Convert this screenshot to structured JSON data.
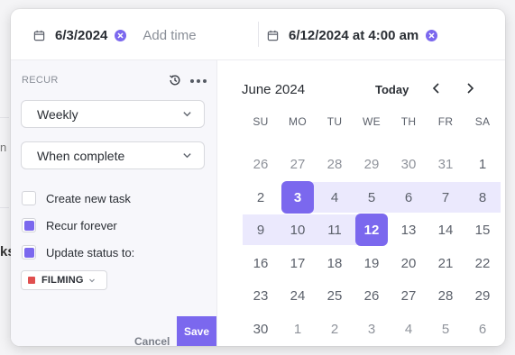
{
  "background": {
    "fragment_1": "n",
    "fragment_2": "ks"
  },
  "header": {
    "start_date": "6/3/2024",
    "add_time_placeholder": "Add time",
    "due_date": "6/12/2024 at 4:00 am"
  },
  "recur": {
    "label": "RECUR",
    "frequency": "Weekly",
    "trigger": "When complete",
    "options": [
      {
        "label": "Create new task",
        "checked": false
      },
      {
        "label": "Recur forever",
        "checked": true
      },
      {
        "label": "Update status to:",
        "checked": true
      }
    ],
    "status": {
      "label": "FILMING",
      "color": "#e04f4f"
    },
    "cancel_label": "Cancel",
    "save_label": "Save"
  },
  "calendar": {
    "month_label": "June 2024",
    "today_label": "Today",
    "weekdays": [
      "SU",
      "MO",
      "TU",
      "WE",
      "TH",
      "FR",
      "SA"
    ],
    "weeks": [
      [
        26,
        27,
        28,
        29,
        30,
        31,
        1
      ],
      [
        2,
        3,
        4,
        5,
        6,
        7,
        8
      ],
      [
        9,
        10,
        11,
        12,
        13,
        14,
        15
      ],
      [
        16,
        17,
        18,
        19,
        20,
        21,
        22
      ],
      [
        23,
        24,
        25,
        26,
        27,
        28,
        29
      ],
      [
        30,
        1,
        2,
        3,
        4,
        5,
        6
      ]
    ],
    "range_start": 3,
    "range_end": 12,
    "accent_color": "#7b68ee",
    "range_color": "#ebe9fd"
  }
}
